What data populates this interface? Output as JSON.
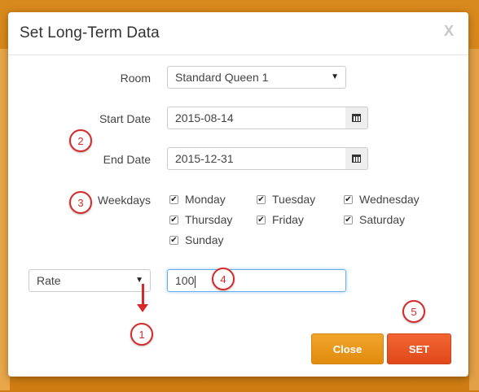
{
  "dialog": {
    "title": "Set Long-Term Data",
    "close_x": "X"
  },
  "form": {
    "room_label": "Room",
    "room_value": "Standard Queen 1",
    "start_label": "Start Date",
    "start_value": "2015-08-14",
    "end_label": "End Date",
    "end_value": "2015-12-31",
    "weekdays_label": "Weekdays",
    "weekdays": [
      {
        "label": "Monday",
        "checked": true
      },
      {
        "label": "Tuesday",
        "checked": true
      },
      {
        "label": "Wednesday",
        "checked": true
      },
      {
        "label": "Thursday",
        "checked": true
      },
      {
        "label": "Friday",
        "checked": true
      },
      {
        "label": "Saturday",
        "checked": true
      },
      {
        "label": "Sunday",
        "checked": true
      }
    ],
    "type_select_value": "Rate",
    "value_input": "100"
  },
  "buttons": {
    "close": "Close",
    "set": "SET"
  },
  "annotations": {
    "markers": [
      "1",
      "2",
      "3",
      "4",
      "5"
    ],
    "marker_color": "#d62a2a"
  },
  "icons": {
    "calendar": "calendar-icon",
    "dropdown": "caret-down-icon",
    "check": "check-icon"
  },
  "colors": {
    "close_button": "#f2a52b",
    "set_button": "#f26633",
    "backdrop": "#d98a1c"
  }
}
